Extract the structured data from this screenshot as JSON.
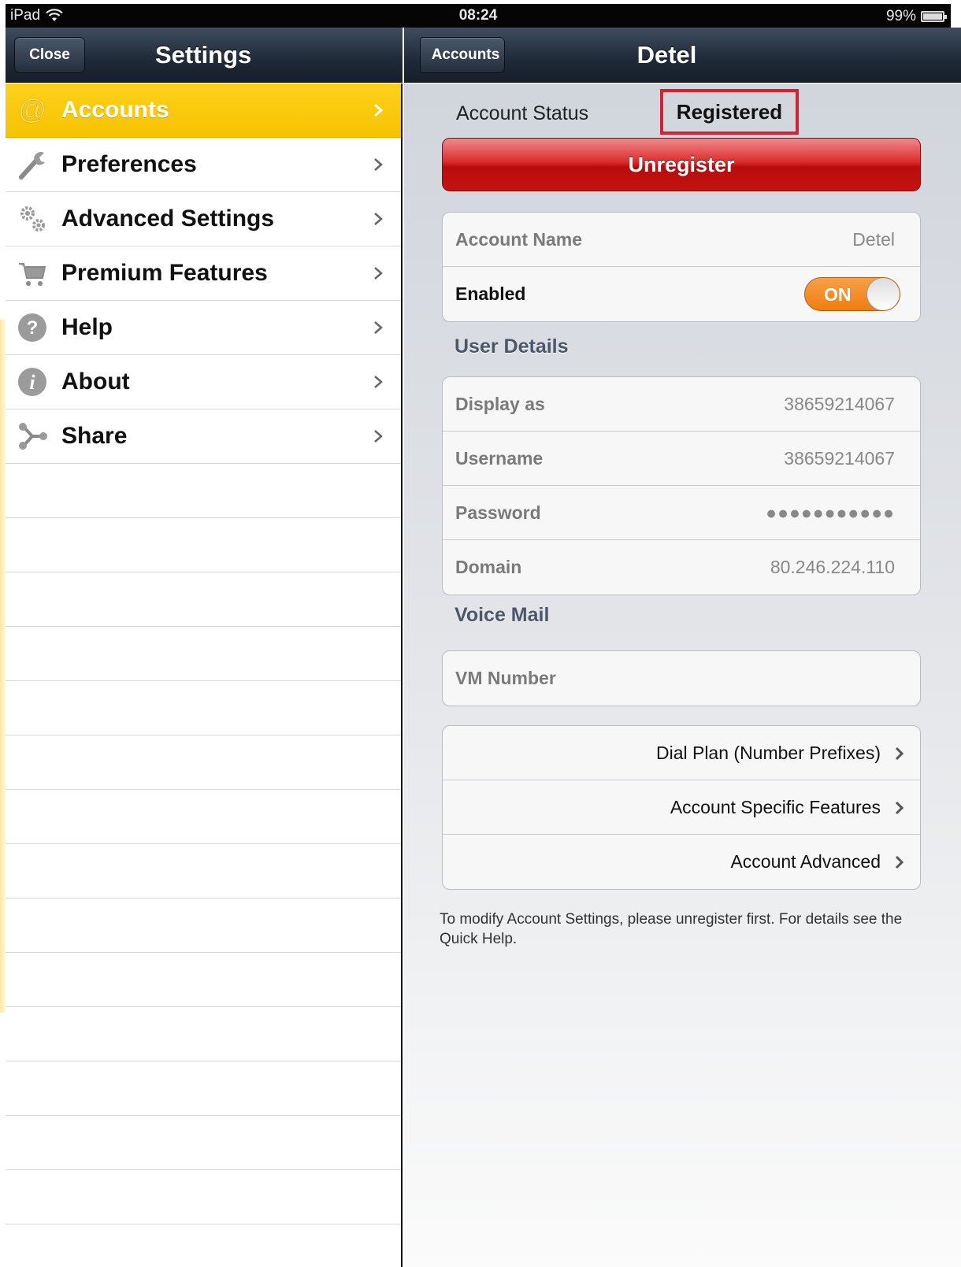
{
  "status_bar": {
    "carrier": "iPad",
    "time": "08:24",
    "battery": "99%"
  },
  "left_nav": {
    "title": "Settings",
    "close_label": "Close"
  },
  "right_nav": {
    "title": "Detel",
    "back_label": "Accounts"
  },
  "sidebar": {
    "items": [
      {
        "label": "Accounts",
        "icon": "at-sign-icon"
      },
      {
        "label": "Preferences",
        "icon": "wrench-icon"
      },
      {
        "label": "Advanced Settings",
        "icon": "gears-icon"
      },
      {
        "label": "Premium Features",
        "icon": "cart-icon"
      },
      {
        "label": "Help",
        "icon": "question-icon"
      },
      {
        "label": "About",
        "icon": "info-icon"
      },
      {
        "label": "Share",
        "icon": "share-icon"
      }
    ],
    "selected": "Accounts",
    "selected_color": "#f9c80e"
  },
  "detail": {
    "account_status_label": "Account Status",
    "account_status_value": "Registered",
    "unregister_label": "Unregister",
    "account_name_label": "Account Name",
    "account_name_value": "Detel",
    "enabled_label": "Enabled",
    "enabled_toggle": "ON",
    "user_details_header": "User Details",
    "display_as_label": "Display as",
    "display_as_value": "38659214067",
    "username_label": "Username",
    "username_value": "38659214067",
    "password_label": "Password",
    "password_value": "●●●●●●●●●●●",
    "domain_label": "Domain",
    "domain_value": "80.246.224.110",
    "voice_mail_header": "Voice Mail",
    "vm_number_label": "VM Number",
    "links": [
      "Dial Plan (Number Prefixes)",
      "Account Specific Features",
      "Account Advanced"
    ],
    "note": "To modify Account Settings, please unregister first.  For details see the Quick Help.",
    "highlight_color": "#d7202f",
    "toggle_color": "#f28a1f"
  }
}
